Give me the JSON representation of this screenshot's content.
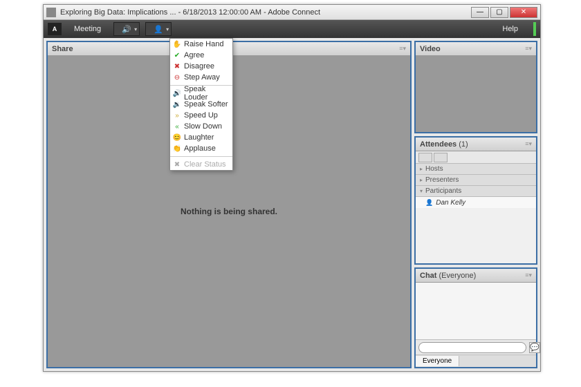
{
  "window": {
    "title": "Exploring Big Data: Implications ... - 6/18/2013 12:00:00 AM - Adobe Connect"
  },
  "menubar": {
    "adobe": "A",
    "meeting": "Meeting",
    "help": "Help"
  },
  "share": {
    "title": "Share",
    "empty_msg": "Nothing is being shared."
  },
  "video": {
    "title": "Video"
  },
  "attendees": {
    "title": "Attendees",
    "count": "(1)",
    "sections": {
      "hosts": "Hosts",
      "presenters": "Presenters",
      "participants": "Participants"
    },
    "participant_name": "Dan Kelly"
  },
  "chat": {
    "title": "Chat",
    "scope": "(Everyone)",
    "tab": "Everyone"
  },
  "status_menu": {
    "raise_hand": "Raise Hand",
    "agree": "Agree",
    "disagree": "Disagree",
    "step_away": "Step Away",
    "speak_louder": "Speak Louder",
    "speak_softer": "Speak Softer",
    "speed_up": "Speed Up",
    "slow_down": "Slow Down",
    "laughter": "Laughter",
    "applause": "Applause",
    "clear": "Clear Status"
  }
}
